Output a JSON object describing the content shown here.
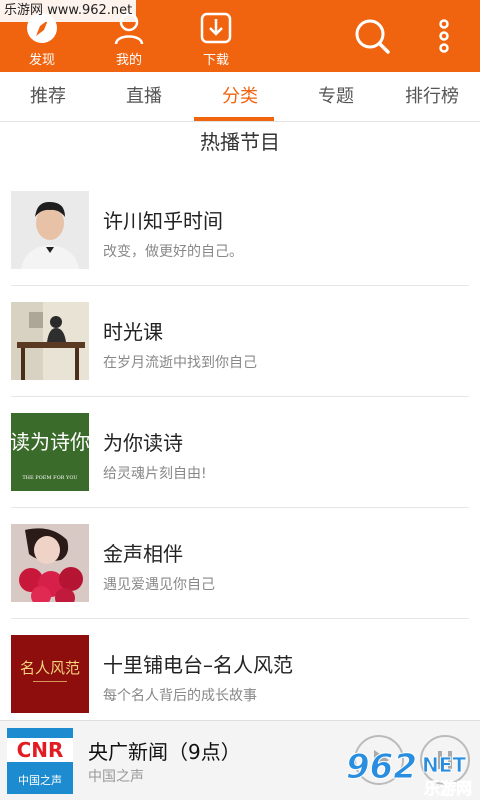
{
  "watermark": "乐游网 www.962.net",
  "topbar": {
    "find_label": "发现",
    "mine_label": "我的",
    "download_label": "下载"
  },
  "tabs": [
    {
      "label": "推荐"
    },
    {
      "label": "直播"
    },
    {
      "label": "分类"
    },
    {
      "label": "专题"
    },
    {
      "label": "排行榜"
    }
  ],
  "active_tab": "分类",
  "section_title": "热播节目",
  "programs": [
    {
      "title": "许川知乎时间",
      "subtitle": "改变，做更好的自己。"
    },
    {
      "title": "时光课",
      "subtitle": "在岁月流逝中找到你自己"
    },
    {
      "title": "为你读诗",
      "subtitle": "给灵魂片刻自由!"
    },
    {
      "title": "金声相伴",
      "subtitle": "遇见爱遇见你自己"
    },
    {
      "title": "十里铺电台–名人风范",
      "subtitle": "每个名人背后的成长故事"
    }
  ],
  "thumb_text": {
    "poem_main": "读为诗你",
    "poem_en": "THE POEM FOR YOU",
    "celebrity": "名人风范"
  },
  "player": {
    "title": "央广新闻（9点）",
    "subtitle": "中国之声",
    "cover_logo": "CNR",
    "cover_sub": "中国之声"
  },
  "brand": {
    "logo": "962",
    "suffix": "NET",
    "name": "乐游网"
  },
  "colors": {
    "accent": "#f06410",
    "divider": "#e6e6e6"
  }
}
